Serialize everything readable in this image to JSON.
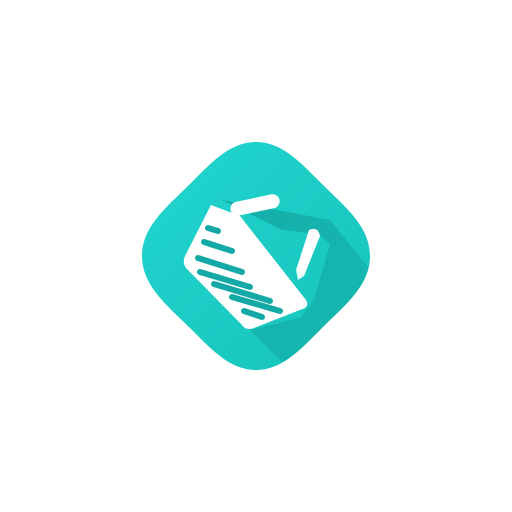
{
  "app_icon": {
    "name": "notes-document-icon",
    "accent_color": "#16c2bb",
    "accent_color_light": "#21d6cf",
    "shadow_color": "#0e8f8c",
    "glyph_color": "#ffffff",
    "line_color": "#14a9a6"
  }
}
